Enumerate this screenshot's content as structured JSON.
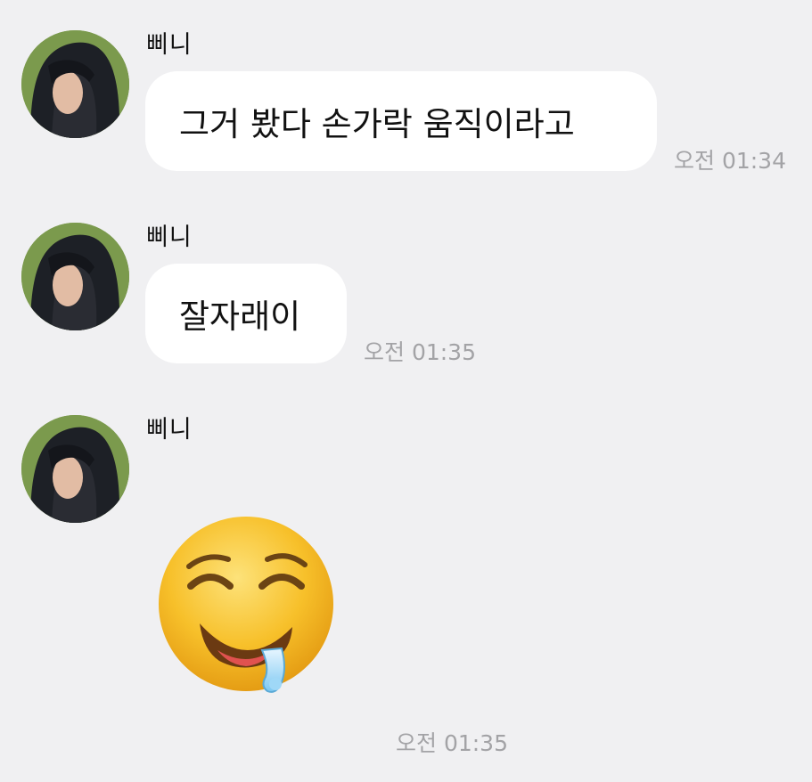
{
  "messages": [
    {
      "sender": "삐니",
      "text": "그거 봤다 손가락 움직이라고",
      "time": "오전 01:34"
    },
    {
      "sender": "삐니",
      "text": "잘자래이",
      "time": "오전 01:35"
    },
    {
      "sender": "삐니",
      "emoji": "drooling-face",
      "time": "오전 01:35"
    }
  ],
  "colors": {
    "background": "#f0f0f2",
    "bubble": "#ffffff",
    "timestamp": "#a3a3a6",
    "emoji_face": "#f7c02a"
  }
}
